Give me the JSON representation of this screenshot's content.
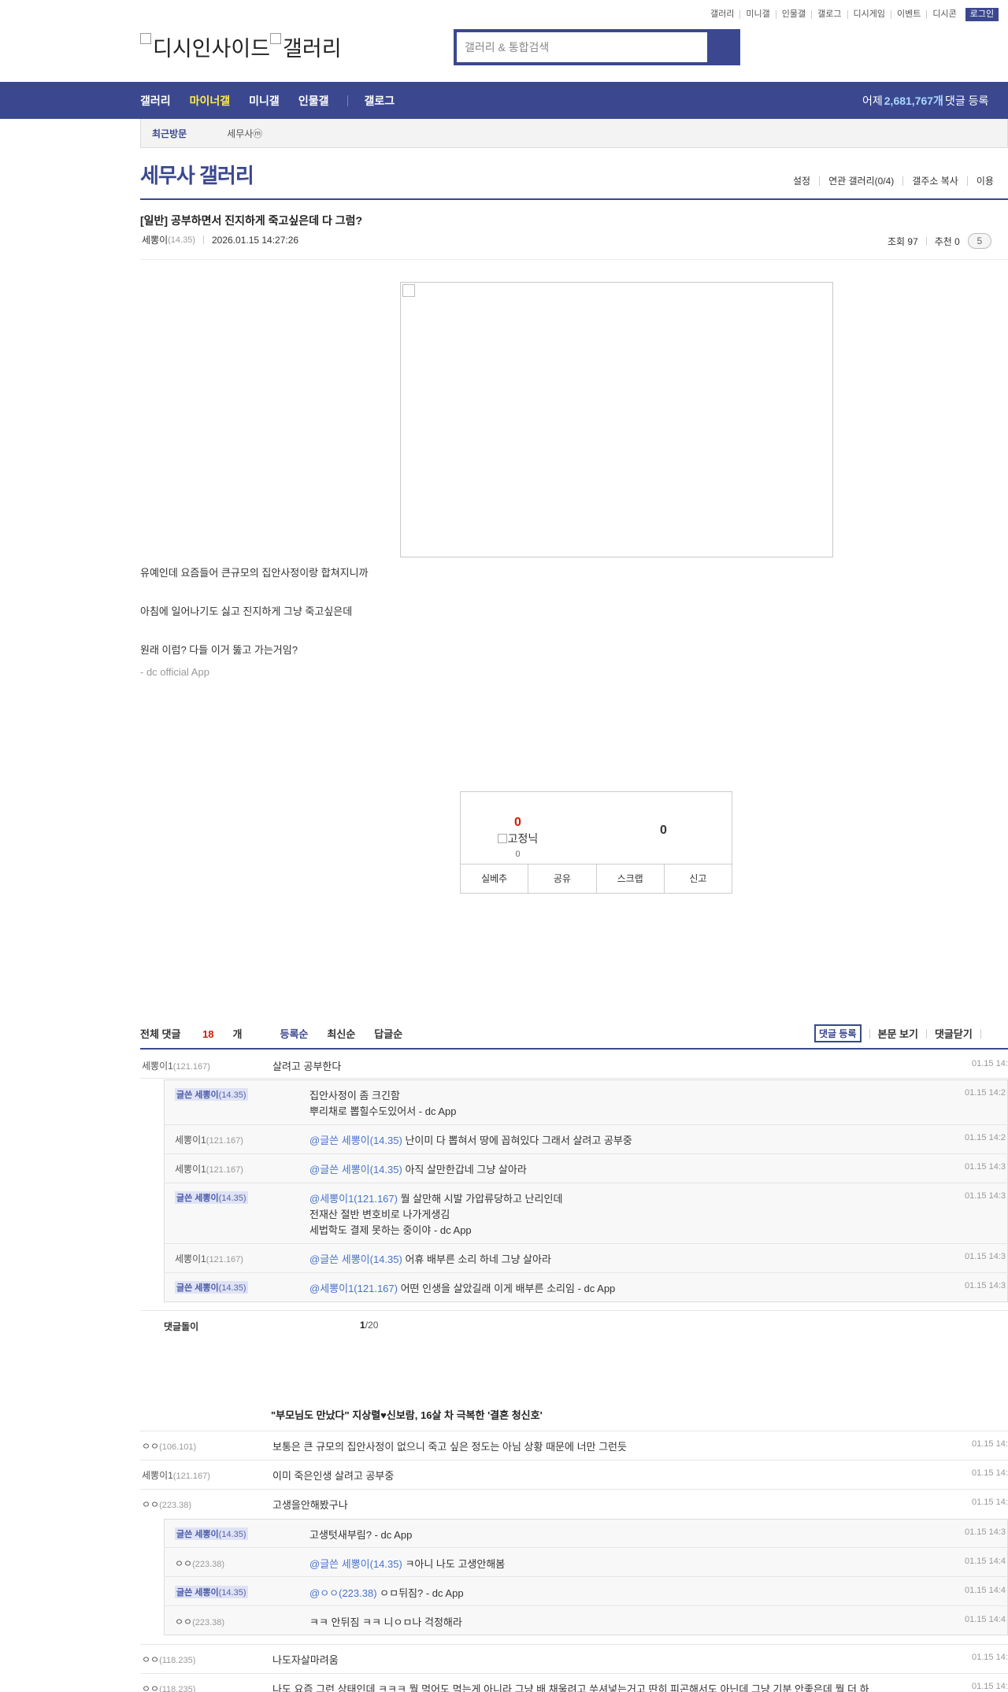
{
  "util_links": [
    "갤러리",
    "미니갤",
    "인물갤",
    "갤로그",
    "디시게임",
    "이벤트",
    "디시콘"
  ],
  "login_label": "로그인",
  "logo": {
    "part1": "디시인사이드",
    "part2": "갤러리"
  },
  "search": {
    "placeholder": "갤러리 & 통합검색"
  },
  "gnb": {
    "items": [
      "갤러리",
      "마이너갤",
      "미니갤",
      "인물갤",
      "갤로그"
    ],
    "stat_prefix": "어제",
    "stat_count": "2,681,767개",
    "stat_suffix": "댓글 등록"
  },
  "recent": {
    "title": "최근방문",
    "item": "세무사ⓜ"
  },
  "gallery": {
    "title": "세무사 갤러리",
    "options": [
      "설정",
      "연관 갤러리(0/4)",
      "갤주소 복사",
      "이용"
    ]
  },
  "post": {
    "title": "[일반] 공부하면서 진지하게 죽고싶은데 다 그럼?",
    "author": "세뽕이",
    "author_ip": "(14.35)",
    "date": "2026.01.15 14:27:26",
    "views": "조회 97",
    "recommend": "추천 0",
    "comment_pill": "5",
    "body": [
      "유예인데 요즘들어 큰규모의 집안사정이랑 합쳐지니까",
      "아침에 일어나기도 싫고 진지하게 그냥 죽고싶은데",
      "원래 이럼? 다들 이거 뚫고 가는거임?"
    ],
    "footer": "- dc official App"
  },
  "recommend_box": {
    "up_count": "0",
    "up_label": "고정닉",
    "up_sub": "0",
    "down_count": "0",
    "buttons": [
      "실베추",
      "공유",
      "스크랩",
      "신고"
    ]
  },
  "comments_header": {
    "total_prefix": "전체 댓글",
    "total_count": "18",
    "total_suffix": "개",
    "sorts": [
      "등록순",
      "최신순",
      "답글순"
    ],
    "actions": [
      "댓글 등록",
      "본문 보기",
      "댓글닫기"
    ]
  },
  "comments": [
    {
      "nick": "세뽕이1",
      "ip": "(121.167)",
      "text": "살려고 공부한다",
      "date": "01.15 14:"
    },
    {
      "nick": "글쓴 세뽕이",
      "ip": "(14.35)",
      "text": "집안사정이 좀 크긴함",
      "text2": "뿌리채로 뽑힐수도있어서 - dc App",
      "date": "01.15 14:2"
    },
    {
      "nick": "세뽕이1",
      "ip": "(121.167)",
      "mention": "@글쓴 세뽕이(14.35)",
      "text": "난이미 다 뽑혀서 땅에 꼽혀있다 그래서 살려고 공부중",
      "date": "01.15 14:2"
    },
    {
      "nick": "세뽕이1",
      "ip": "(121.167)",
      "mention": "@글쓴 세뽕이(14.35)",
      "text": "아직 살만한갑네 그냥 살아라",
      "date": "01.15 14:3"
    },
    {
      "nick": "글쓴 세뽕이",
      "ip": "(14.35)",
      "mention": "@세뽕이1(121.167)",
      "text": "뭘 살만해 시발 가압류당하고 난리인데",
      "text2": "전재산 절반 변호비로 나가게생김",
      "text3": "세법학도 결제 못하는 중이야 - dc App",
      "date": "01.15 14:3"
    },
    {
      "nick": "세뽕이1",
      "ip": "(121.167)",
      "mention": "@글쓴 세뽕이(14.35)",
      "text": "어휴 배부른 소리 하네 그냥 살아라",
      "date": "01.15 14:3"
    },
    {
      "nick": "글쓴 세뽕이",
      "ip": "(14.35)",
      "mention": "@세뽕이1(121.167)",
      "text": "어떤 인생을 살았길래 이게 배부른 소리임 - dc App",
      "date": "01.15 14:3"
    },
    {
      "nick": "ㅇㅇ",
      "ip": "(106.101)",
      "text": "보통은 큰 규모의 집안사정이 없으니 죽고 싶은 정도는 아님 상황 때문에 너만 그런듯",
      "date": "01.15 14:"
    },
    {
      "nick": "세뽕이1",
      "ip": "(121.167)",
      "text": "이미 죽은인생 살려고 공부중",
      "date": "01.15 14:"
    },
    {
      "nick": "ㅇㅇ",
      "ip": "(223.38)",
      "text": "고생을안해봤구나",
      "date": "01.15 14:"
    },
    {
      "nick": "글쓴 세뽕이",
      "ip": "(14.35)",
      "text": "고생텃새부림? - dc App",
      "date": "01.15 14:3"
    },
    {
      "nick": "ㅇㅇ",
      "ip": "(223.38)",
      "mention": "@글쓴 세뽕이(14.35)",
      "text": "ㅋ아니 나도 고생안해봄",
      "date": "01.15 14:4"
    },
    {
      "nick": "글쓴 세뽕이",
      "ip": "(14.35)",
      "mention": "@ㅇㅇ(223.38)",
      "text": "ㅇㅁ뒤짐? - dc App",
      "date": "01.15 14:4"
    },
    {
      "nick": "ㅇㅇ",
      "ip": "(223.38)",
      "text": "ㅋㅋ 안뒤짐 ㅋㅋ 니ㅇㅁ나 걱정해라",
      "date": "01.15 14:4"
    },
    {
      "nick": "ㅇㅇ",
      "ip": "(118.235)",
      "text": "나도자살마려움",
      "date": "01.15 14:"
    },
    {
      "nick": "ㅇㅇ",
      "ip": "(118.235)",
      "text": "나도 요즘 그런 상태인데 ㅋㅋㅋ 뭘 먹어도 먹는게 아니라 그냥 배 채울려고 쑤셔넣는거고 딴히 피곤해서도 아닌데 그냥 기분 안좋은데 뭘 더 하",
      "date": "01.15 14:"
    }
  ],
  "comment_footer": {
    "label": "댓글돌이",
    "page": "1",
    "total": "/20"
  },
  "ad_headline": "\"부모님도 만났다\" 지상렬♥신보람, 16살 차 극복한 '결혼 청신호'"
}
